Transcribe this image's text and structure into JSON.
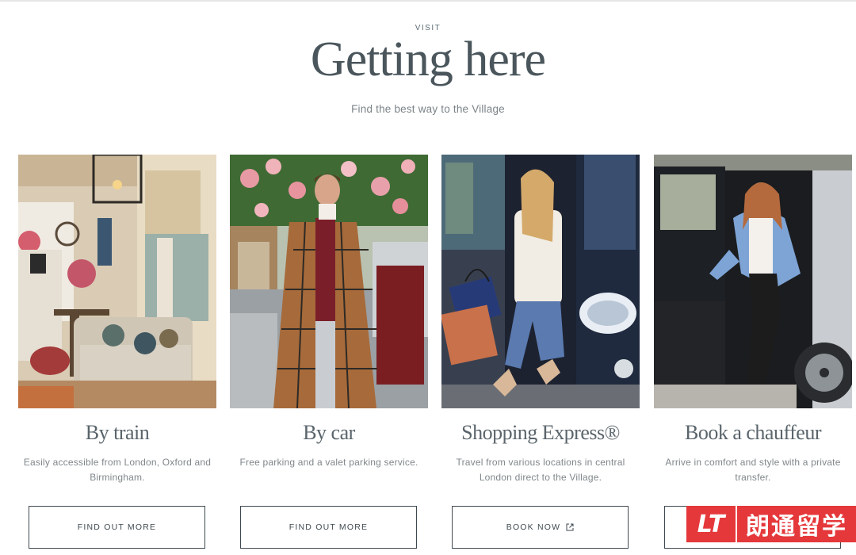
{
  "header": {
    "eyebrow": "VISIT",
    "title": "Getting here",
    "subtitle": "Find the best way to the Village"
  },
  "cards": [
    {
      "heading": "By train",
      "description": "Easily accessible from London, Oxford and Birmingham.",
      "button_label": "FIND OUT MORE",
      "image": "hotel-lobby-photo"
    },
    {
      "heading": "By car",
      "description": "Free parking and a valet parking service.",
      "button_label": "FIND OUT MORE",
      "image": "man-in-check-coat-photo"
    },
    {
      "heading": "Shopping Express®",
      "description": "Travel from various locations in central London direct to the Village.",
      "button_label": "BOOK NOW",
      "button_icon": "external-link-icon",
      "image": "woman-boarding-coach-photo"
    },
    {
      "heading": "Book a chauffeur",
      "description": "Arrive in comfort and style with a private transfer.",
      "button_label": "",
      "image": "woman-exiting-car-photo"
    }
  ],
  "watermark": {
    "logo": "LT",
    "text": "朗通留学",
    "color": "#e5383b"
  },
  "colors": {
    "heading": "#4a565c",
    "body_text": "#80878b",
    "button_border": "#3f4a50"
  }
}
